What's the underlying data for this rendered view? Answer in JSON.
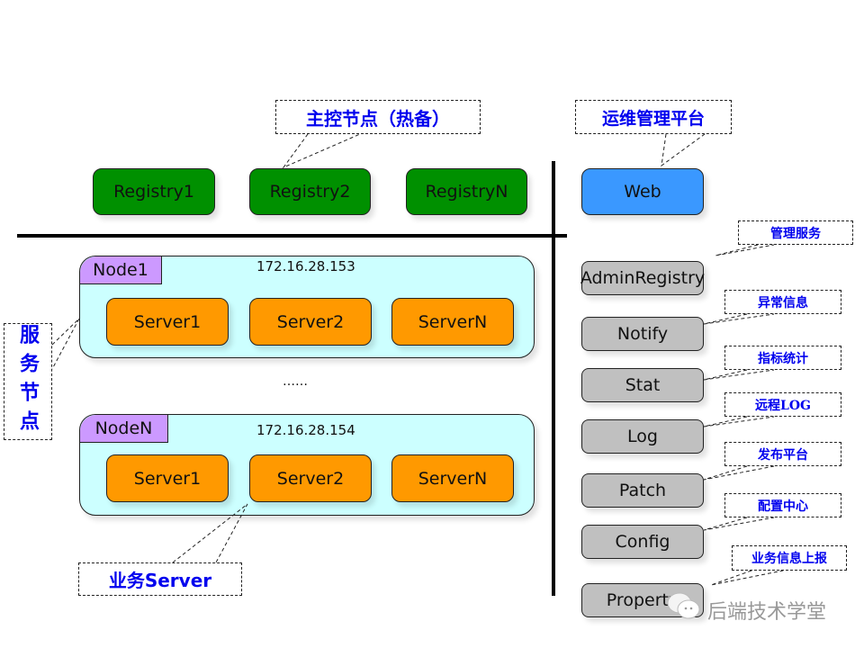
{
  "master": {
    "callout": "主控节点（热备）",
    "registries": [
      "Registry1",
      "Registry2",
      "RegistryN"
    ]
  },
  "ops": {
    "callout": "运维管理平台",
    "web": "Web"
  },
  "service_nodes": {
    "callout": "服务节点",
    "ellipsis": "……",
    "nodes": [
      {
        "name": "Node1",
        "ip": "172.16.28.153",
        "servers": [
          "Server1",
          "Server2",
          "ServerN"
        ]
      },
      {
        "name": "NodeN",
        "ip": "172.16.28.154",
        "servers": [
          "Server1",
          "Server2",
          "ServerN"
        ]
      }
    ],
    "business_callout": "业务Server"
  },
  "services": [
    {
      "name": "AdminRegistry",
      "callout": "管理服务"
    },
    {
      "name": "Notify",
      "callout": "异常信息"
    },
    {
      "name": "Stat",
      "callout": "指标统计"
    },
    {
      "name": "Log",
      "callout": "远程LOG"
    },
    {
      "name": "Patch",
      "callout": "发布平台"
    },
    {
      "name": "Config",
      "callout": "配置中心"
    },
    {
      "name": "Property",
      "callout": "业务信息上报"
    }
  ],
  "colors": {
    "registry": "#009000",
    "web": "#3a98ff",
    "server": "#ff9900",
    "node": "#ccffff",
    "node_tag": "#cc99ff",
    "service": "#c0c0c0",
    "callout_text": "#0000ee"
  },
  "watermark": "后端技术学堂"
}
